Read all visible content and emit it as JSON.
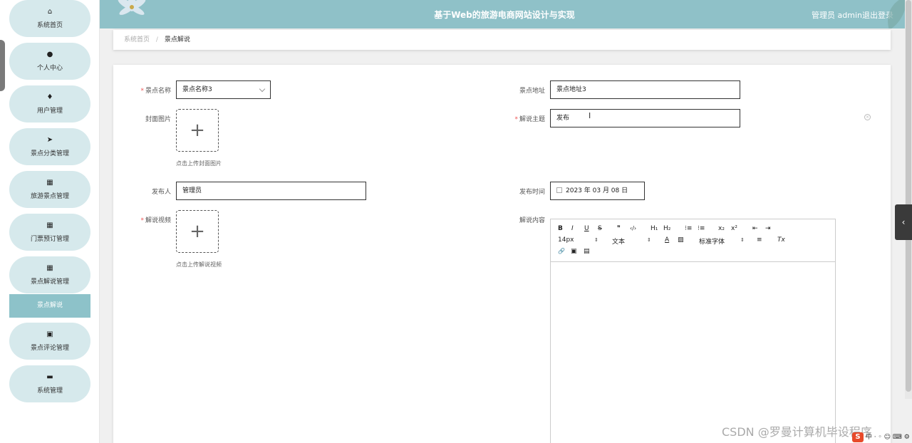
{
  "header": {
    "title": "基于Web的旅游电商网站设计与实现",
    "user": "管理员 admin",
    "logout": "退出登录"
  },
  "sidebar": {
    "items": [
      {
        "label": "系统首页",
        "icon": "home-icon",
        "glyph": "⌂"
      },
      {
        "label": "个人中心",
        "icon": "person-icon",
        "glyph": "●"
      },
      {
        "label": "用户管理",
        "icon": "map-pin-icon",
        "glyph": "♦"
      },
      {
        "label": "景点分类管理",
        "icon": "send-icon",
        "glyph": "➤"
      },
      {
        "label": "旅游景点管理",
        "icon": "grid-icon",
        "glyph": "▦"
      },
      {
        "label": "门票预订管理",
        "icon": "grid-icon",
        "glyph": "▦"
      },
      {
        "label": "景点解说管理",
        "icon": "grid-icon",
        "glyph": "▦"
      },
      {
        "label": "景点评论管理",
        "icon": "clipboard-icon",
        "glyph": "▣"
      },
      {
        "label": "系统管理",
        "icon": "monitor-icon",
        "glyph": "▬"
      }
    ],
    "submenu_active": "景点解说"
  },
  "breadcrumb": {
    "home": "系统首页",
    "separator": "/",
    "current": "景点解说"
  },
  "form": {
    "scenic_name_label": "景点名称",
    "scenic_name_value": "景点名称3",
    "scenic_address_label": "景点地址",
    "scenic_address_value": "景点地址3",
    "cover_label": "封面图片",
    "cover_hint": "点击上传封面图片",
    "topic_label": "解说主题",
    "topic_value": "发布",
    "publisher_label": "发布人",
    "publisher_value": "管理员",
    "publish_time_label": "发布时间",
    "publish_time_value": "2023 年 03 月 08 日",
    "video_label": "解说视频",
    "video_hint": "点击上传解说视频",
    "content_label": "解说内容",
    "required_mark": "*",
    "plus": "+"
  },
  "editor": {
    "bold": "B",
    "italic": "I",
    "underline": "U",
    "strike": "S",
    "quote": "❞",
    "code": "‹/›",
    "h1": "H₁",
    "h2": "H₂",
    "ordered_list": "⁝≡",
    "bullet_list": "⁝≡",
    "subscript": "x₂",
    "superscript": "x²",
    "outdent": "⇤",
    "indent": "⇥",
    "font_size": "14px",
    "text_style": "文本",
    "font_color": "A",
    "bg_color": "▨",
    "font_family": "标准字体",
    "align": "≡",
    "clean": "Tx",
    "link": "🔗",
    "image": "▣",
    "video": "▤",
    "select_arrow": "⇕"
  },
  "watermark": "CSDN @罗曼计算机毕设程序",
  "ime": {
    "logo": "S",
    "text": "中 · ◦ ☺ ⌨ ⚙ ⊞"
  },
  "colors": {
    "header_bg": "#8fc1c8",
    "menu_bg": "#d6e9ec",
    "submenu_active_bg": "#8dc2c9"
  }
}
